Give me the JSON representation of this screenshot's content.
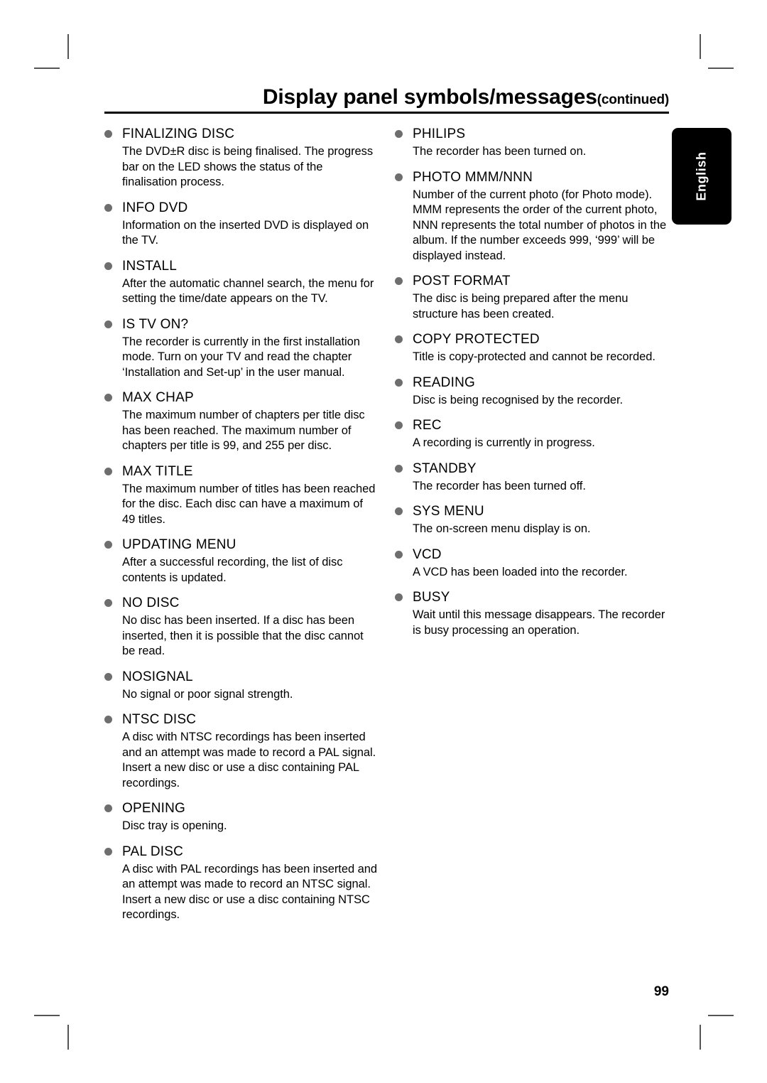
{
  "header": {
    "title": "Display panel symbols/messages",
    "continued": "(continued)"
  },
  "language_tab": {
    "label": "English"
  },
  "page_number": "99",
  "columns": {
    "left": [
      {
        "term": "FINALIZING DISC",
        "desc": "The DVD±R disc is being finalised. The progress bar on the LED shows the status of the finalisation process."
      },
      {
        "term": "INFO DVD",
        "desc": "Information on the inserted DVD is displayed on the TV."
      },
      {
        "term": "INSTALL",
        "desc": "After the automatic channel search, the menu for setting the time/date appears on the TV."
      },
      {
        "term": "IS TV ON?",
        "desc": "The recorder is currently in the first installation mode. Turn on your TV and read the chapter ‘Installation and Set-up’ in the user manual."
      },
      {
        "term": "MAX CHAP",
        "desc": "The maximum number of chapters per title disc has been reached. The maximum number of chapters per title is 99, and 255 per disc."
      },
      {
        "term": "MAX TITLE",
        "desc": "The maximum number of titles has been reached for the disc. Each disc can have a maximum of 49 titles."
      },
      {
        "term": "UPDATING MENU",
        "desc": "After a successful recording, the list of disc contents is updated."
      },
      {
        "term": "NO DISC",
        "desc": "No disc has been inserted. If a disc has been inserted, then it is possible that the disc cannot be read."
      },
      {
        "term": "NOSIGNAL",
        "desc": "No signal or poor signal strength."
      },
      {
        "term": "NTSC DISC",
        "desc": "A disc with NTSC recordings has been inserted and an attempt was made to record a PAL signal. Insert a new disc or use a disc containing PAL recordings."
      },
      {
        "term": "OPENING",
        "desc": "Disc tray is opening."
      },
      {
        "term": "PAL DISC",
        "desc": "A disc with PAL recordings has been inserted and an attempt was made to record an NTSC signal. Insert a new disc or use a disc containing NTSC recordings."
      }
    ],
    "right": [
      {
        "term": "PHILIPS",
        "desc": "The recorder has been turned on."
      },
      {
        "term": "PHOTO MMM/NNN",
        "desc": "Number of the current photo (for Photo mode). MMM represents the order of the current photo, NNN represents the total number of photos in the album. If the number exceeds 999, ‘999’ will be displayed instead."
      },
      {
        "term": "POST FORMAT",
        "desc": "The disc is being prepared after the menu structure has been created."
      },
      {
        "term": "COPY PROTECTED",
        "desc": "Title is copy-protected and cannot be recorded."
      },
      {
        "term": "READING",
        "desc": "Disc is being recognised by the recorder."
      },
      {
        "term": "REC",
        "desc": "A recording is currently in progress."
      },
      {
        "term": "STANDBY",
        "desc": "The recorder has been turned off."
      },
      {
        "term": "SYS MENU",
        "desc": "The on-screen menu display is on."
      },
      {
        "term": "VCD",
        "desc": "A VCD has been loaded into the recorder."
      },
      {
        "term": "BUSY",
        "desc": "Wait until this message disappears. The recorder is busy processing an operation."
      }
    ]
  }
}
